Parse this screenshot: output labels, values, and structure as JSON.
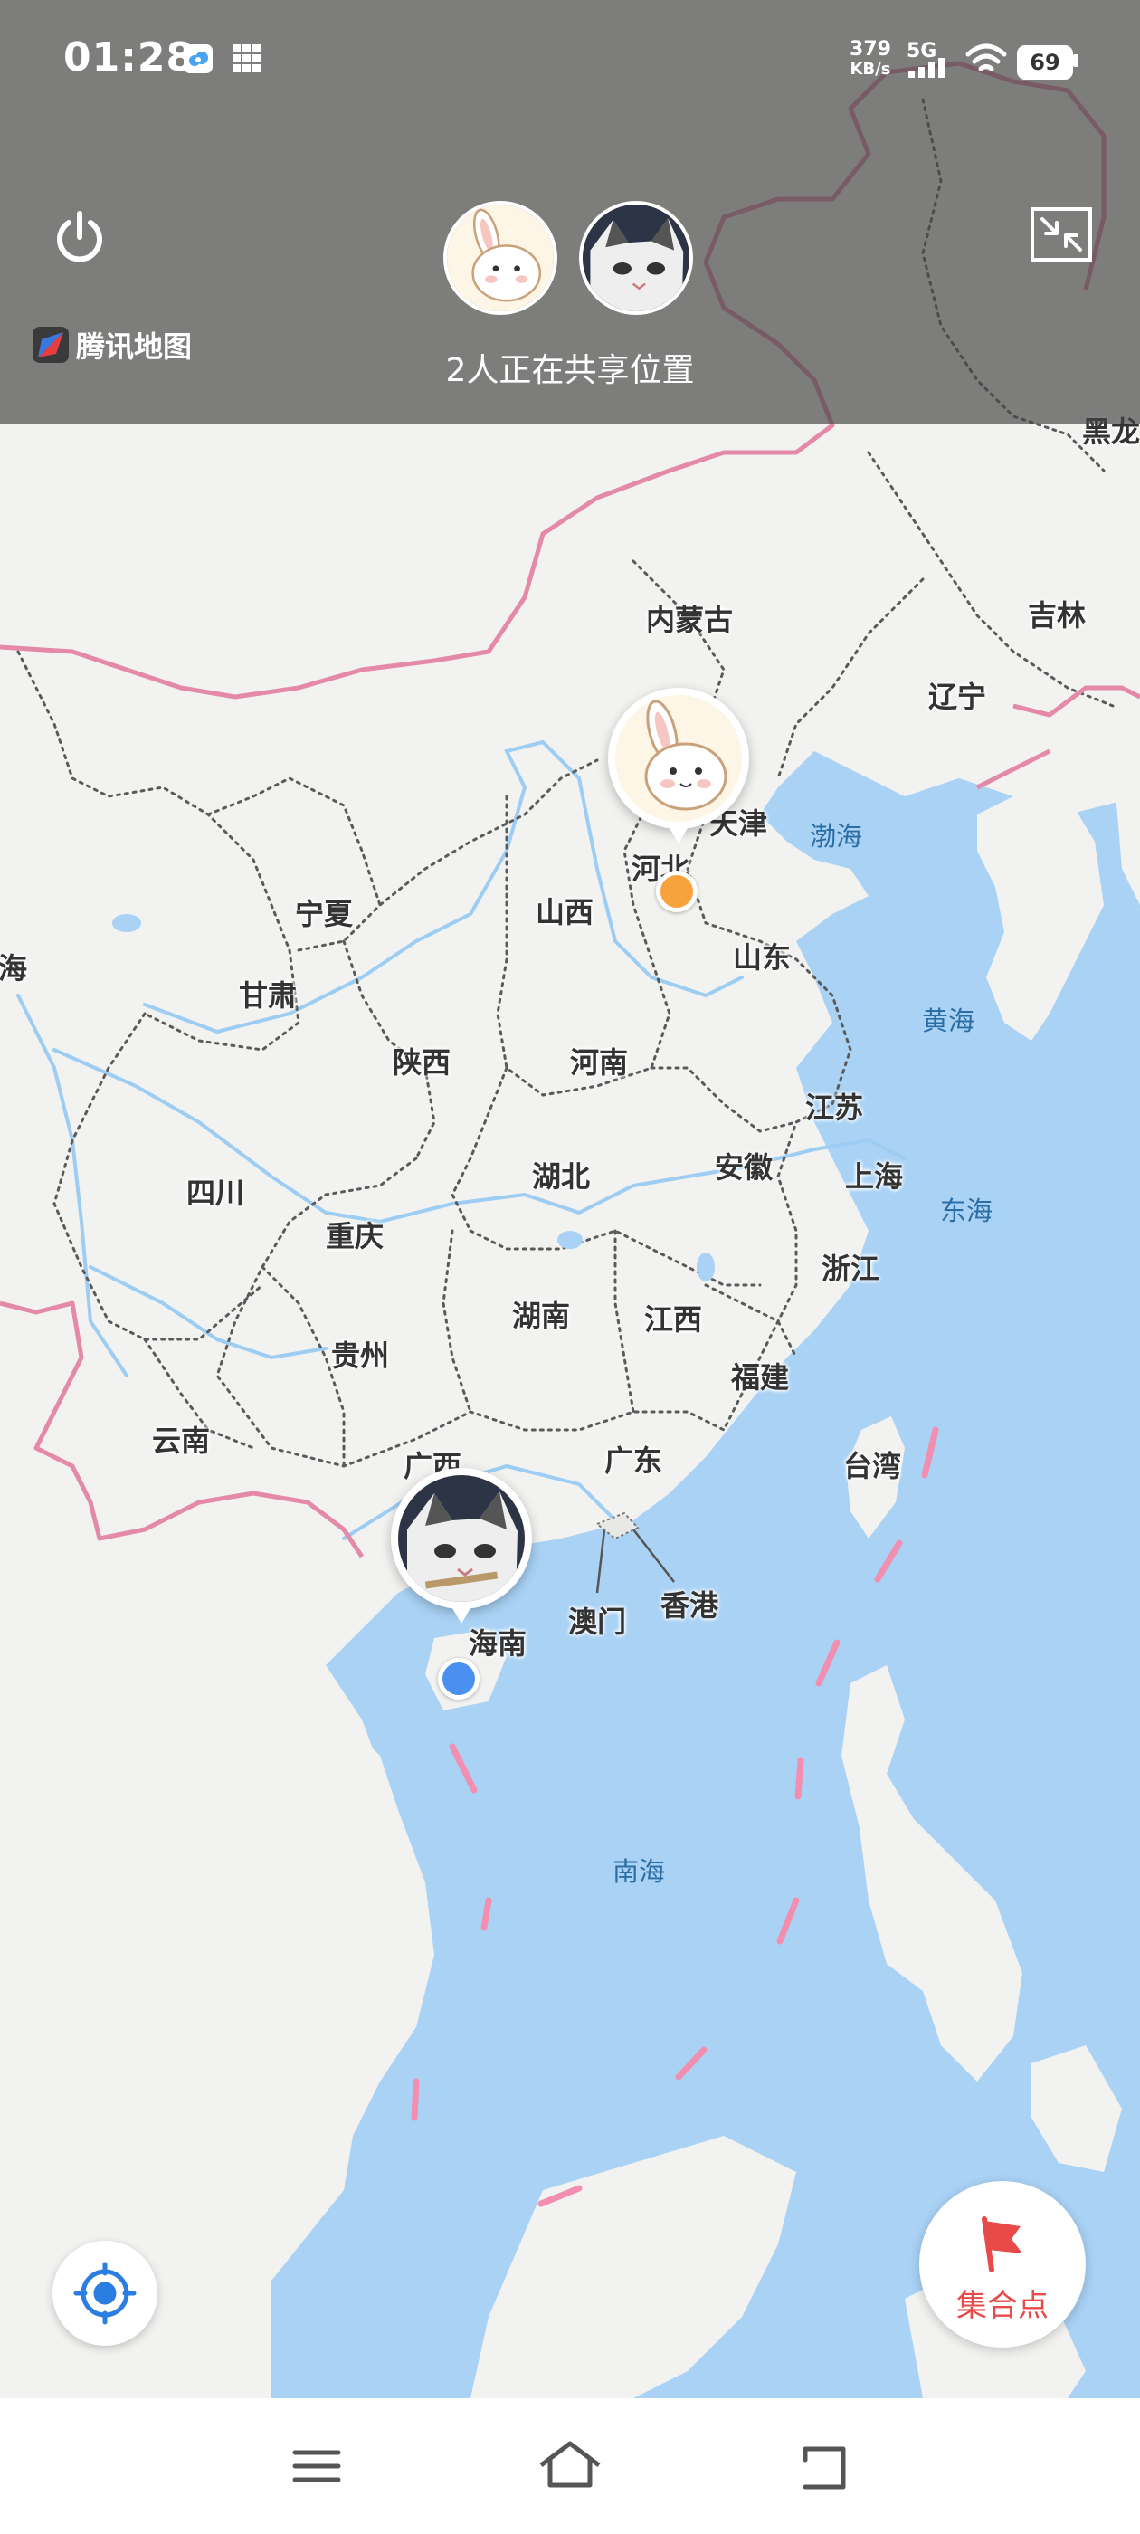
{
  "status_bar": {
    "time": "01:28",
    "net_speed_value": "379",
    "net_speed_unit": "KB/s",
    "network": "5G",
    "battery": "69"
  },
  "header": {
    "brand": "腾讯地图",
    "sharing_text": "2人正在共享位置"
  },
  "map": {
    "regions": [
      "内蒙古",
      "黑龙",
      "吉林",
      "辽宁",
      "天津",
      "河北",
      "山西",
      "宁夏",
      "甘肃",
      "海",
      "山东",
      "陕西",
      "河南",
      "江苏",
      "四川",
      "湖北",
      "安徽",
      "上海",
      "重庆",
      "浙江",
      "湖南",
      "江西",
      "贵州",
      "福建",
      "云南",
      "广西",
      "广东",
      "台湾",
      "澳门",
      "香港",
      "海南"
    ],
    "seas": [
      "渤海",
      "黄海",
      "东海",
      "南海"
    ],
    "colors": {
      "land": "#f2f2f0",
      "water": "#a9d2f5",
      "border": "#e48aa8",
      "user_a": "#f7a23c",
      "user_b": "#4a90f0"
    }
  },
  "buttons": {
    "gather_point": "集合点"
  },
  "icons": {
    "power": "power-icon",
    "collapse": "collapse-icon",
    "locate": "locate-icon",
    "flag": "flag-icon",
    "menu": "menu-icon",
    "home": "home-icon",
    "back": "back-icon"
  }
}
